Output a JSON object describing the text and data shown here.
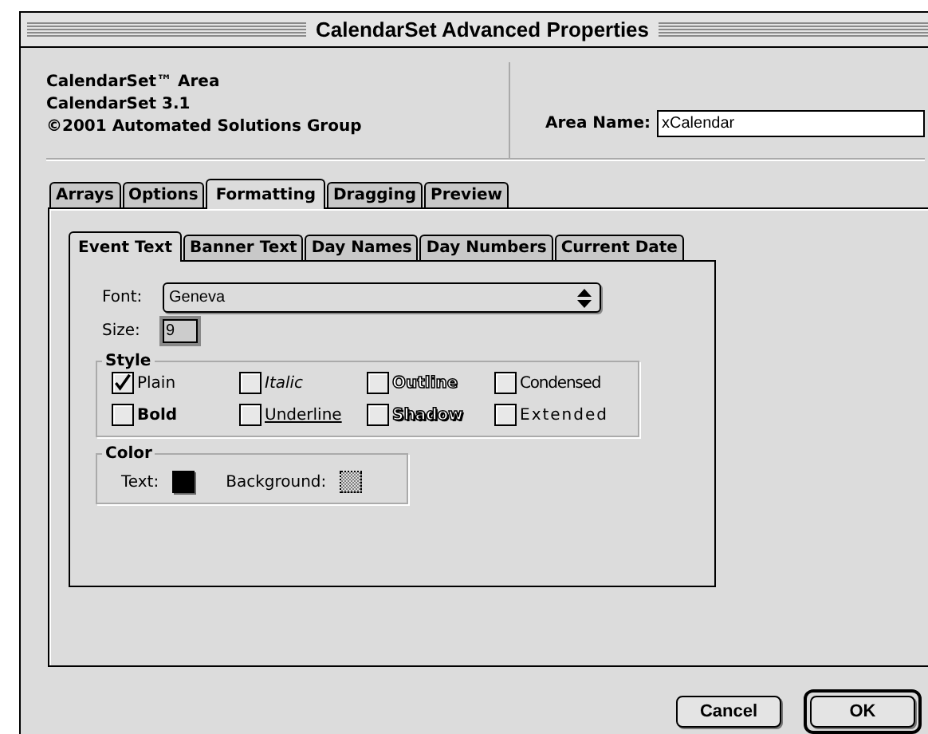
{
  "window": {
    "title": "CalendarSet Advanced Properties"
  },
  "header": {
    "lines": [
      "CalendarSet™ Area",
      "CalendarSet 3.1",
      "©2001 Automated Solutions Group"
    ],
    "area_name": {
      "label": "Area Name:",
      "value": "xCalendar"
    }
  },
  "tabs": [
    {
      "label": "Arrays",
      "selected": false
    },
    {
      "label": "Options",
      "selected": false
    },
    {
      "label": "Formatting",
      "selected": true
    },
    {
      "label": "Dragging",
      "selected": false
    },
    {
      "label": "Preview",
      "selected": false
    }
  ],
  "subtabs": [
    {
      "label": "Event Text",
      "selected": true
    },
    {
      "label": "Banner Text",
      "selected": false
    },
    {
      "label": "Day Names",
      "selected": false
    },
    {
      "label": "Day Numbers",
      "selected": false
    },
    {
      "label": "Current Date",
      "selected": false
    }
  ],
  "font": {
    "label": "Font:",
    "value": "Geneva"
  },
  "size": {
    "label": "Size:",
    "value": "9"
  },
  "style": {
    "title": "Style",
    "options": [
      {
        "label": "Plain",
        "kind": "plain",
        "checked": true
      },
      {
        "label": "Italic",
        "kind": "italic",
        "checked": false
      },
      {
        "label": "Outline",
        "kind": "outline",
        "checked": false
      },
      {
        "label": "Condensed",
        "kind": "condensed",
        "checked": false
      },
      {
        "label": "Bold",
        "kind": "bold",
        "checked": false
      },
      {
        "label": "Underline",
        "kind": "underline",
        "checked": false
      },
      {
        "label": "Shadow",
        "kind": "shadow",
        "checked": false
      },
      {
        "label": "Extended",
        "kind": "extended",
        "checked": false
      }
    ]
  },
  "color": {
    "title": "Color",
    "swatches": [
      {
        "label": "Text:",
        "kind": "solid",
        "color": "#000000"
      },
      {
        "label": "Background:",
        "kind": "dither",
        "color": "#808080"
      }
    ]
  },
  "buttons": [
    {
      "label": "Cancel",
      "kind": "normal"
    },
    {
      "label": "OK",
      "kind": "default"
    }
  ]
}
